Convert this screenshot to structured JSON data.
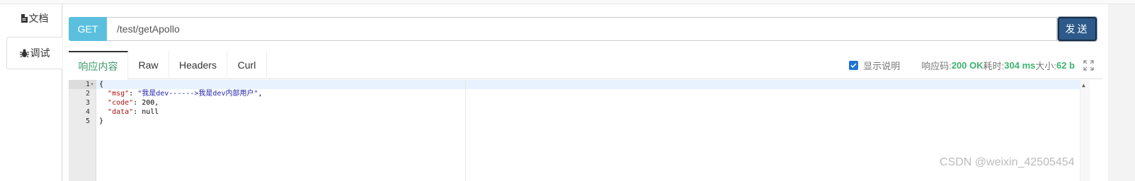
{
  "sidebar": {
    "tabs": [
      {
        "label": "文档"
      },
      {
        "label": "调试"
      }
    ]
  },
  "request": {
    "method": "GET",
    "url": "/test/getApollo",
    "send_label": "发送"
  },
  "response": {
    "tabs": [
      {
        "label": "响应内容"
      },
      {
        "label": "Raw"
      },
      {
        "label": "Headers"
      },
      {
        "label": "Curl"
      }
    ],
    "show_desc_label": "显示说明",
    "show_desc_checked": true,
    "status": {
      "code_label": "响应码:",
      "code_value": "200 OK",
      "time_label": "耗时:",
      "time_value": "304 ms",
      "size_label": "大小:",
      "size_value": "62 b"
    },
    "body_lines": [
      {
        "n": "1",
        "text": "{"
      },
      {
        "n": "2",
        "key": "\"msg\"",
        "value": "\"我是dev------>我是dev内部用户\"",
        "tail": ","
      },
      {
        "n": "3",
        "key": "\"code\"",
        "value": "200",
        "tail": ","
      },
      {
        "n": "4",
        "key": "\"data\"",
        "value": "null",
        "tail": ""
      },
      {
        "n": "5",
        "text": "}"
      }
    ]
  },
  "watermark": "CSDN @weixin_42505454",
  "colors": {
    "method_bg": "#5bc0de",
    "send_bg": "#2d5a8a",
    "accent_green": "#3cb371"
  }
}
